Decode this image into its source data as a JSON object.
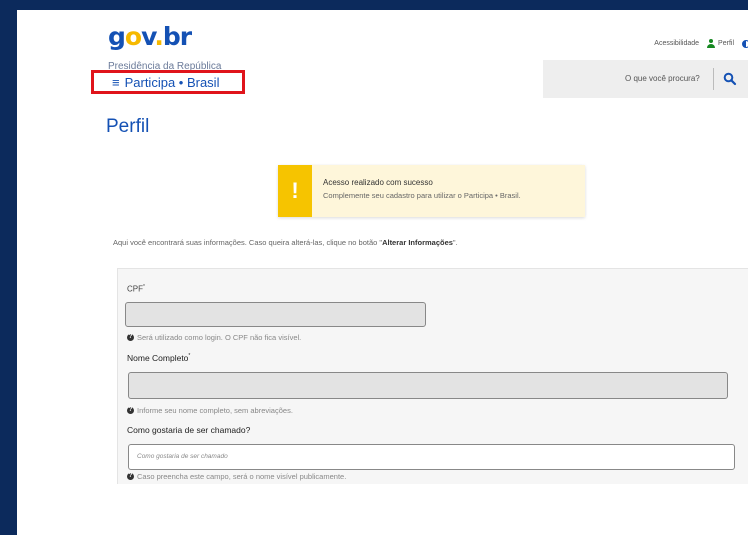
{
  "header": {
    "logo": {
      "g": "g",
      "o": "o",
      "v": "v",
      "dot": ".",
      "br": "br"
    },
    "subtitle": "Presidência da República",
    "brand": "Participa • Brasil",
    "top_links": {
      "accessibility": "Acessibilidade",
      "profile": "Perfil"
    },
    "search_placeholder": "O que você procura?"
  },
  "page_title": "Perfil",
  "alert": {
    "title": "Acesso realizado com sucesso",
    "message": "Complemente seu cadastro para utilizar o Participa • Brasil."
  },
  "info": {
    "prefix": "Aqui você encontrará suas informações. Caso queira alterá-las, clique no botão \"",
    "button_ref": "Alterar Informações",
    "suffix": "\"."
  },
  "form": {
    "cpf_label": "CPF",
    "cpf_required": "*",
    "cpf_value": "",
    "cpf_hint": "Será utilizado como login. O CPF não fica visível.",
    "name_label": "Nome Completo",
    "name_required": "*",
    "name_value": "",
    "name_hint": "Informe seu nome completo, sem abreviações.",
    "nickname_label": "Como gostaria de ser chamado?",
    "nickname_placeholder": "Como gostaria de ser chamado",
    "nickname_hint": "Caso preencha este campo, será o nome visível publicamente."
  },
  "colors": {
    "primary": "#1451b4",
    "logo_o": "#f6b900",
    "highlight": "#e0141b",
    "alert_bar": "#f6c400",
    "frame": "#0c2a5c"
  },
  "icons": {
    "menu": "hamburger-icon",
    "profile": "person-icon",
    "contrast": "contrast-icon",
    "search": "search-icon",
    "alert": "exclamation-icon",
    "help": "question-icon"
  }
}
